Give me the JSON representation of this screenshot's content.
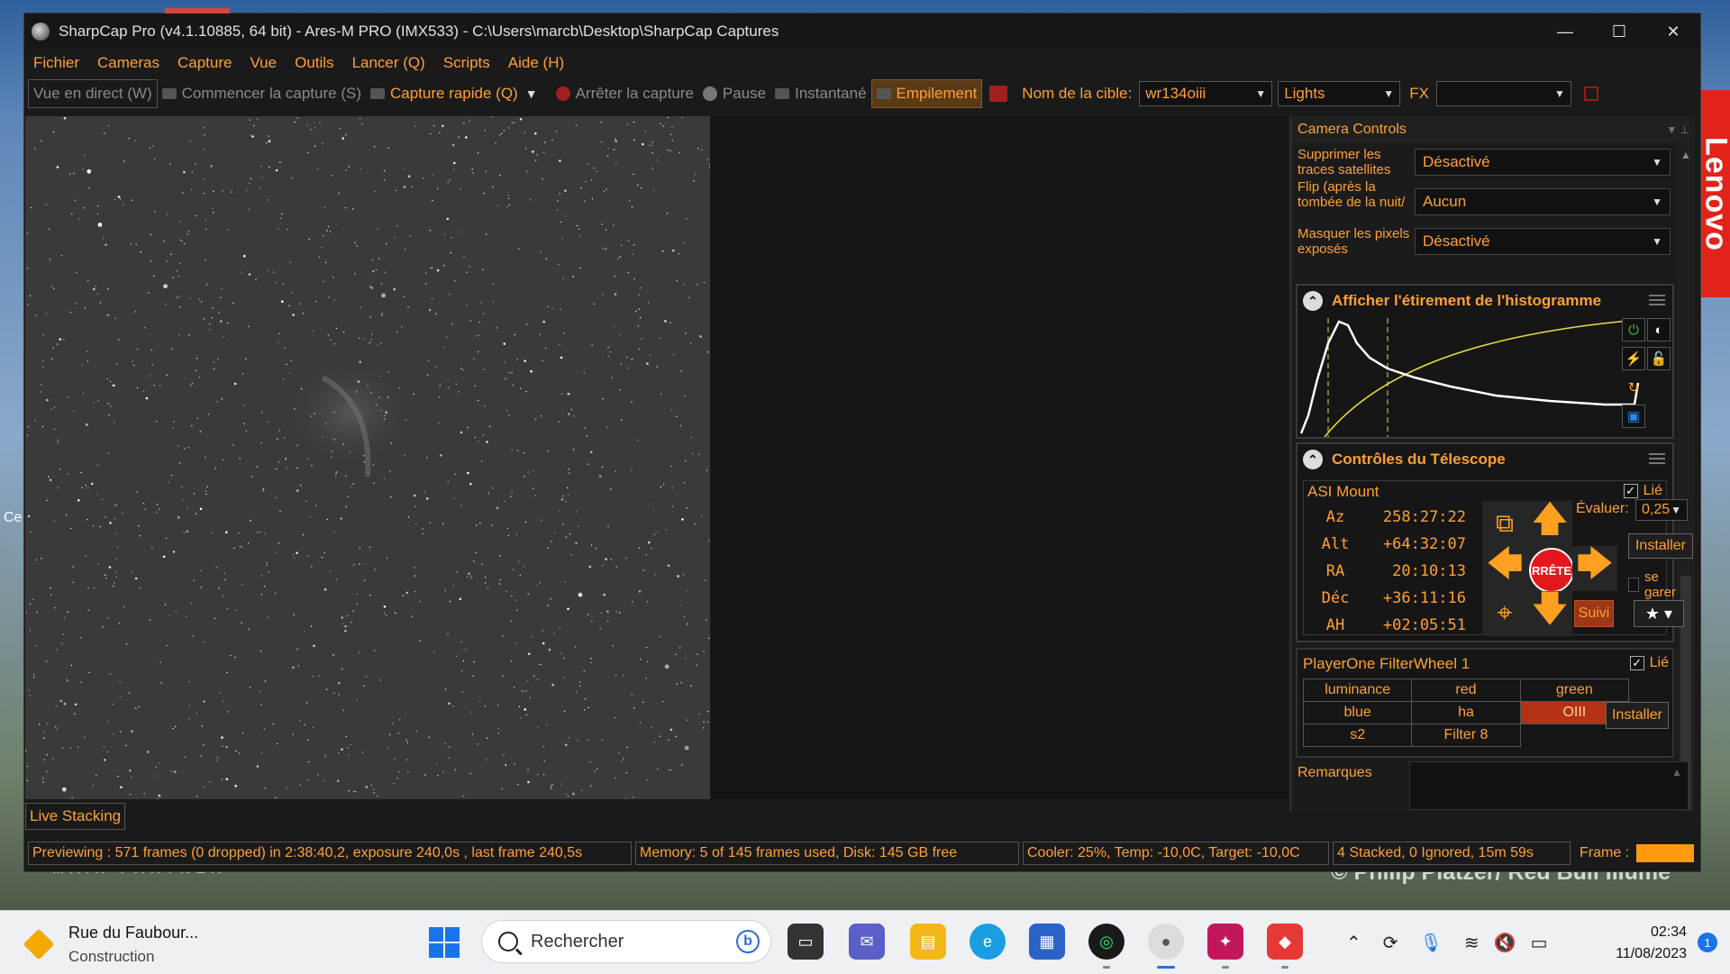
{
  "window": {
    "title": "SharpCap Pro (v4.1.10885, 64 bit) - Ares-M PRO (IMX533) - C:\\Users\\marcb\\Desktop\\SharpCap Captures",
    "controls": [
      "—",
      "☐",
      "✕"
    ]
  },
  "menu": [
    "Fichier",
    "Cameras",
    "Capture",
    "Vue",
    "Outils",
    "Lancer (Q)",
    "Scripts",
    "Aide (H)"
  ],
  "toolbar": {
    "live_view": "Vue en direct (W)",
    "start_capture": "Commencer la capture (S)",
    "quick_capture": "Capture rapide (Q)",
    "stop_capture": "Arrêter la capture",
    "pause": "Pause",
    "snapshot": "Instantané",
    "stacking": "Empilement",
    "target_label": "Nom de la cible:",
    "target_value": "wr134oiii",
    "frame_type": "Lights",
    "fx_label": "FX",
    "fx_value": ""
  },
  "camera_controls": {
    "header": "Camera Controls",
    "rows": [
      {
        "label": "Supprimer les traces satellites",
        "value": "Désactivé"
      },
      {
        "label": "Flip (après la tombée de la nuit/à plat)",
        "value": "Aucun"
      },
      {
        "label": "Masquer les pixels exposés",
        "value": "Désactivé"
      }
    ]
  },
  "histogram": {
    "title": "Afficher l'étirement de l'histogramme"
  },
  "telescope": {
    "title": "Contrôles du Télescope",
    "mount_name": "ASI Mount",
    "linked_label": "Lié",
    "coords": [
      {
        "key": "Az",
        "value": "258:27:22"
      },
      {
        "key": "Alt",
        "value": "+64:32:07"
      },
      {
        "key": "RA",
        "value": "20:10:13"
      },
      {
        "key": "Déc",
        "value": "+36:11:16"
      },
      {
        "key": "AH",
        "value": "+02:05:51"
      }
    ],
    "rate_label": "Évaluer:",
    "rate_value": "0,25",
    "stop_label": "RRÊTE",
    "install_label": "Installer",
    "park_label": "se garer",
    "tracking_label": "Suivi"
  },
  "filterwheel": {
    "name": "PlayerOne FilterWheel 1",
    "linked_label": "Lié",
    "filters": [
      [
        "luminance",
        "red",
        "green"
      ],
      [
        "blue",
        "ha",
        "OIII"
      ],
      [
        "s2",
        "Filter 8",
        ""
      ]
    ],
    "selected": "OIII",
    "install_label": "Installer"
  },
  "notes": {
    "label": "Remarques"
  },
  "live_stacking_tab": "Live Stacking",
  "status": {
    "preview": "Previewing : 571 frames (0 dropped) in 2:38:40,2, exposure 240,0s , last frame 240,5s",
    "memory": "Memory: 5 of 145 frames used, Disk: 145 GB free",
    "cooler": "Cooler: 25%, Temp: -10,0C, Target: -10,0C",
    "stacked": "4 Stacked, 0 Ignored, 15m 59s",
    "frame_label": "Frame :"
  },
  "desktop": {
    "lenovo": "Lenovo",
    "watermark": "© Philip Platzer/ Red Bull Illume",
    "partner": "MAIN PARTNER",
    "left_text": "Ce"
  },
  "taskbar": {
    "weather_title": "Rue du Faubour...",
    "weather_sub": "Construction",
    "search_placeholder": "Rechercher",
    "time": "02:34",
    "date": "11/08/2023",
    "notifications": "1"
  }
}
